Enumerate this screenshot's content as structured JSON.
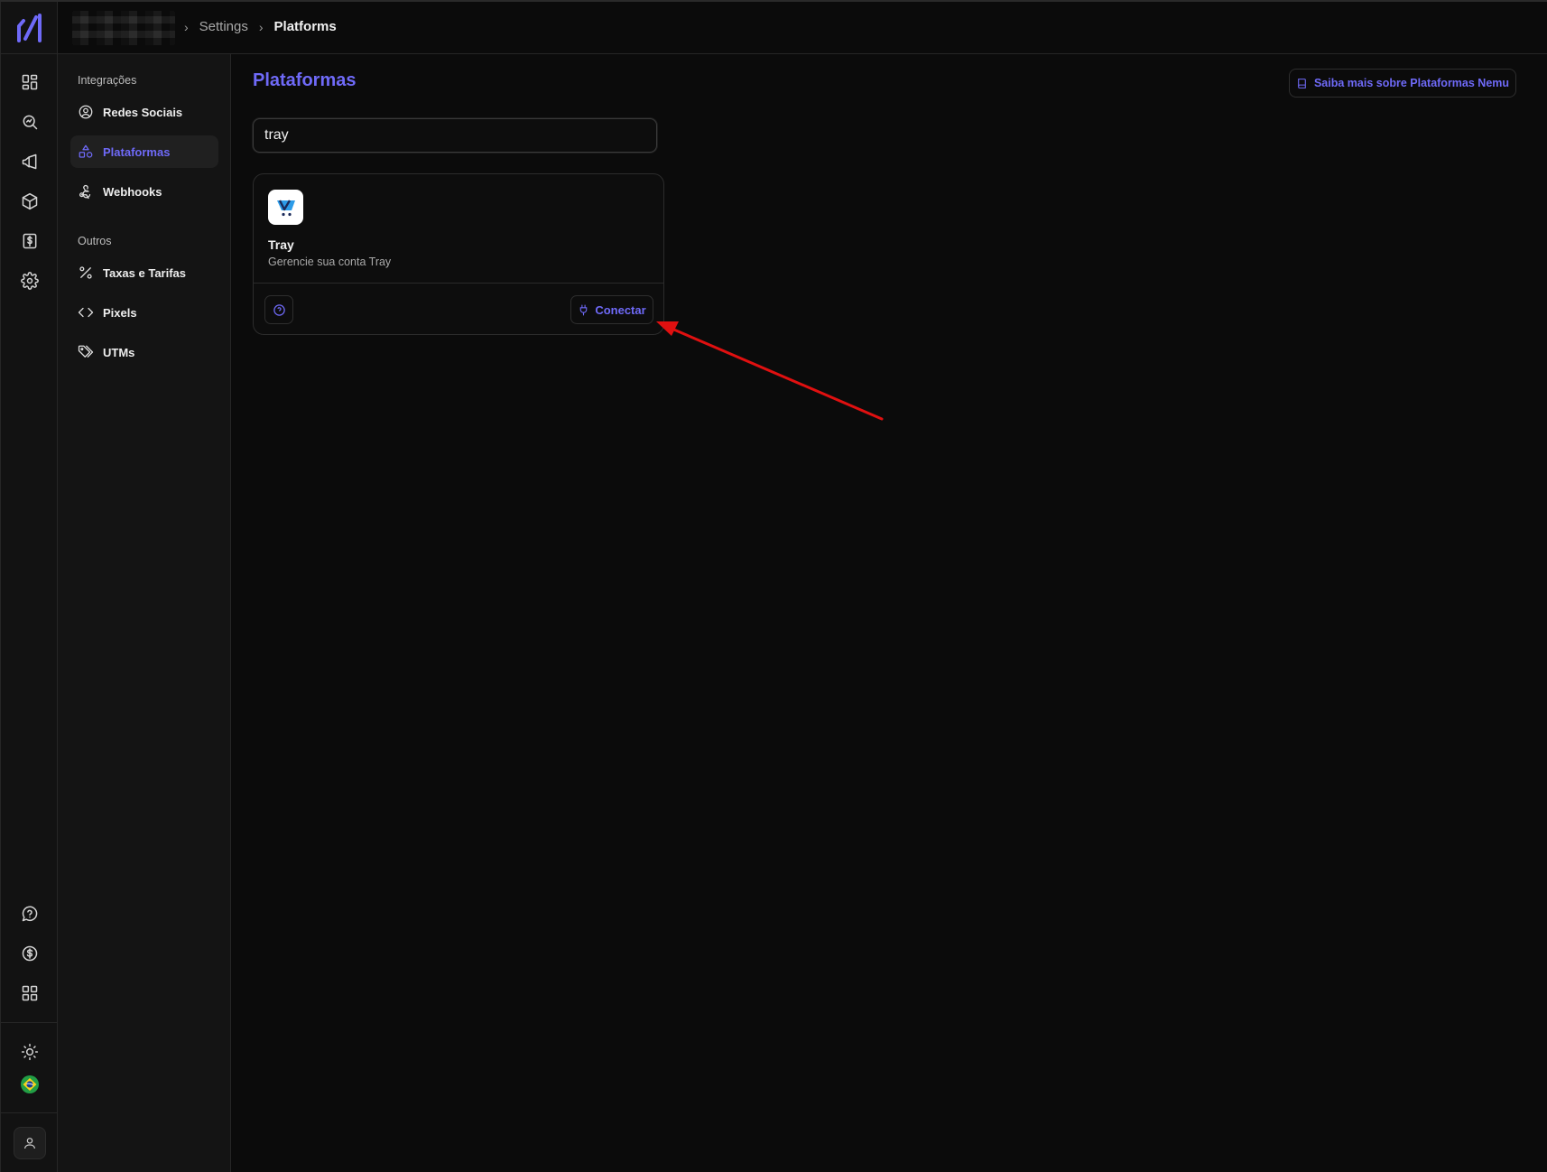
{
  "breadcrumb": {
    "parent": "Settings",
    "current": "Platforms"
  },
  "rail": {
    "icons": [
      "dashboard-icon",
      "search-analytics-icon",
      "megaphone-icon",
      "package-icon",
      "invoice-dollar-icon",
      "settings-icon",
      "support-chat-icon",
      "billing-dollar-icon",
      "apps-grid-icon",
      "theme-sun-icon",
      "brazil-flag-icon",
      "user-icon"
    ]
  },
  "subnav": {
    "section_integrations": "Integrações",
    "section_others": "Outros",
    "items": [
      {
        "label": "Redes Sociais",
        "icon": "user-circle-icon"
      },
      {
        "label": "Plataformas",
        "icon": "shapes-icon",
        "active": true
      },
      {
        "label": "Webhooks",
        "icon": "webhook-icon"
      },
      {
        "label": "Taxas e Tarifas",
        "icon": "percent-icon"
      },
      {
        "label": "Pixels",
        "icon": "code-icon"
      },
      {
        "label": "UTMs",
        "icon": "tags-icon"
      }
    ]
  },
  "main": {
    "title": "Plataformas",
    "docs_button": "Saiba mais sobre Plataformas Nemu",
    "search_value": "tray",
    "card": {
      "name": "Tray",
      "description": "Gerencie sua conta Tray",
      "connect_label": "Conectar"
    }
  },
  "colors": {
    "accent": "#6f6af8",
    "background": "#0b0b0b",
    "annotation_arrow": "#e01010"
  }
}
